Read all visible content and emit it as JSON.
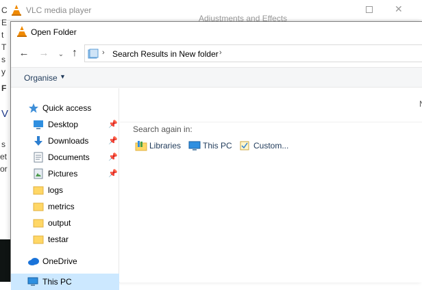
{
  "background_window": {
    "title": "VLC media player",
    "panel_title": "Adjustments and Effects",
    "edge_letters": [
      "C",
      "E",
      "t",
      "T",
      "s",
      "y",
      "F",
      "V",
      "s",
      "et",
      "or"
    ]
  },
  "dialog": {
    "title": "Open Folder",
    "address": {
      "path_text": "Search Results in New folder"
    },
    "toolbar": {
      "organise_label": "Organise"
    },
    "nav": {
      "items": [
        {
          "label": "Quick access",
          "icon": "star-icon"
        },
        {
          "label": "Desktop",
          "icon": "desktop-icon",
          "pinned": true
        },
        {
          "label": "Downloads",
          "icon": "download-icon",
          "pinned": true
        },
        {
          "label": "Documents",
          "icon": "documents-icon",
          "pinned": true
        },
        {
          "label": "Pictures",
          "icon": "pictures-icon",
          "pinned": true
        },
        {
          "label": "logs",
          "icon": "folder-icon"
        },
        {
          "label": "metrics",
          "icon": "folder-icon"
        },
        {
          "label": "output",
          "icon": "folder-icon"
        },
        {
          "label": "testar",
          "icon": "folder-icon"
        },
        {
          "label": "OneDrive",
          "icon": "cloud-icon"
        },
        {
          "label": "This PC",
          "icon": "pc-icon"
        }
      ]
    },
    "content": {
      "column_header_partial": "N",
      "search_again_label": "Search again in:",
      "search_locations": [
        {
          "label": "Libraries",
          "icon": "libraries-icon"
        },
        {
          "label": "This PC",
          "icon": "pc-icon"
        },
        {
          "label": "Custom...",
          "icon": "custom-search-icon"
        }
      ]
    }
  },
  "colors": {
    "link": "#1e3959",
    "selection": "#cce8ff",
    "folder": "#ffd766",
    "vlc_orange": "#f08a00"
  }
}
